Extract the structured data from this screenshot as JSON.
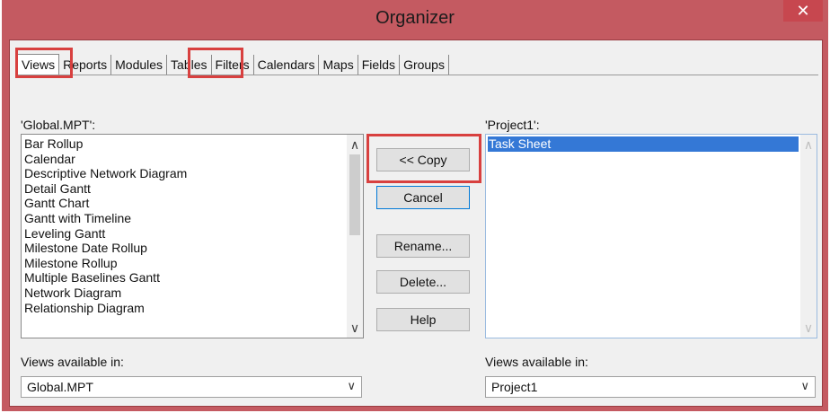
{
  "window": {
    "title": "Organizer",
    "close_glyph": "✕"
  },
  "tabs": [
    {
      "label": "Views"
    },
    {
      "label": "Reports"
    },
    {
      "label": "Modules"
    },
    {
      "label": "Tables"
    },
    {
      "label": "Filters"
    },
    {
      "label": "Calendars"
    },
    {
      "label": "Maps"
    },
    {
      "label": "Fields"
    },
    {
      "label": "Groups"
    }
  ],
  "left_list": {
    "label": "'Global.MPT':",
    "items": [
      "Bar Rollup",
      "Calendar",
      "Descriptive Network Diagram",
      "Detail Gantt",
      "Gantt Chart",
      "Gantt with Timeline",
      "Leveling Gantt",
      "Milestone Date Rollup",
      "Milestone Rollup",
      "Multiple Baselines Gantt",
      "Network Diagram",
      "Relationship Diagram"
    ]
  },
  "right_list": {
    "label": "'Project1':",
    "items": [
      "Task Sheet"
    ]
  },
  "buttons": {
    "copy": "<< Copy",
    "cancel": "Cancel",
    "rename": "Rename...",
    "delete": "Delete...",
    "help": "Help"
  },
  "left_available": {
    "label": "Views available in:",
    "value": "Global.MPT"
  },
  "right_available": {
    "label": "Views available in:",
    "value": "Project1"
  },
  "colors": {
    "accent": "#c45a61",
    "highlight": "#d8403f",
    "selection": "#3478d6"
  },
  "icons": {
    "close": "close-icon",
    "scroll_up": "chevron-up-icon",
    "scroll_down": "chevron-down-icon",
    "dropdown": "chevron-down-icon"
  }
}
